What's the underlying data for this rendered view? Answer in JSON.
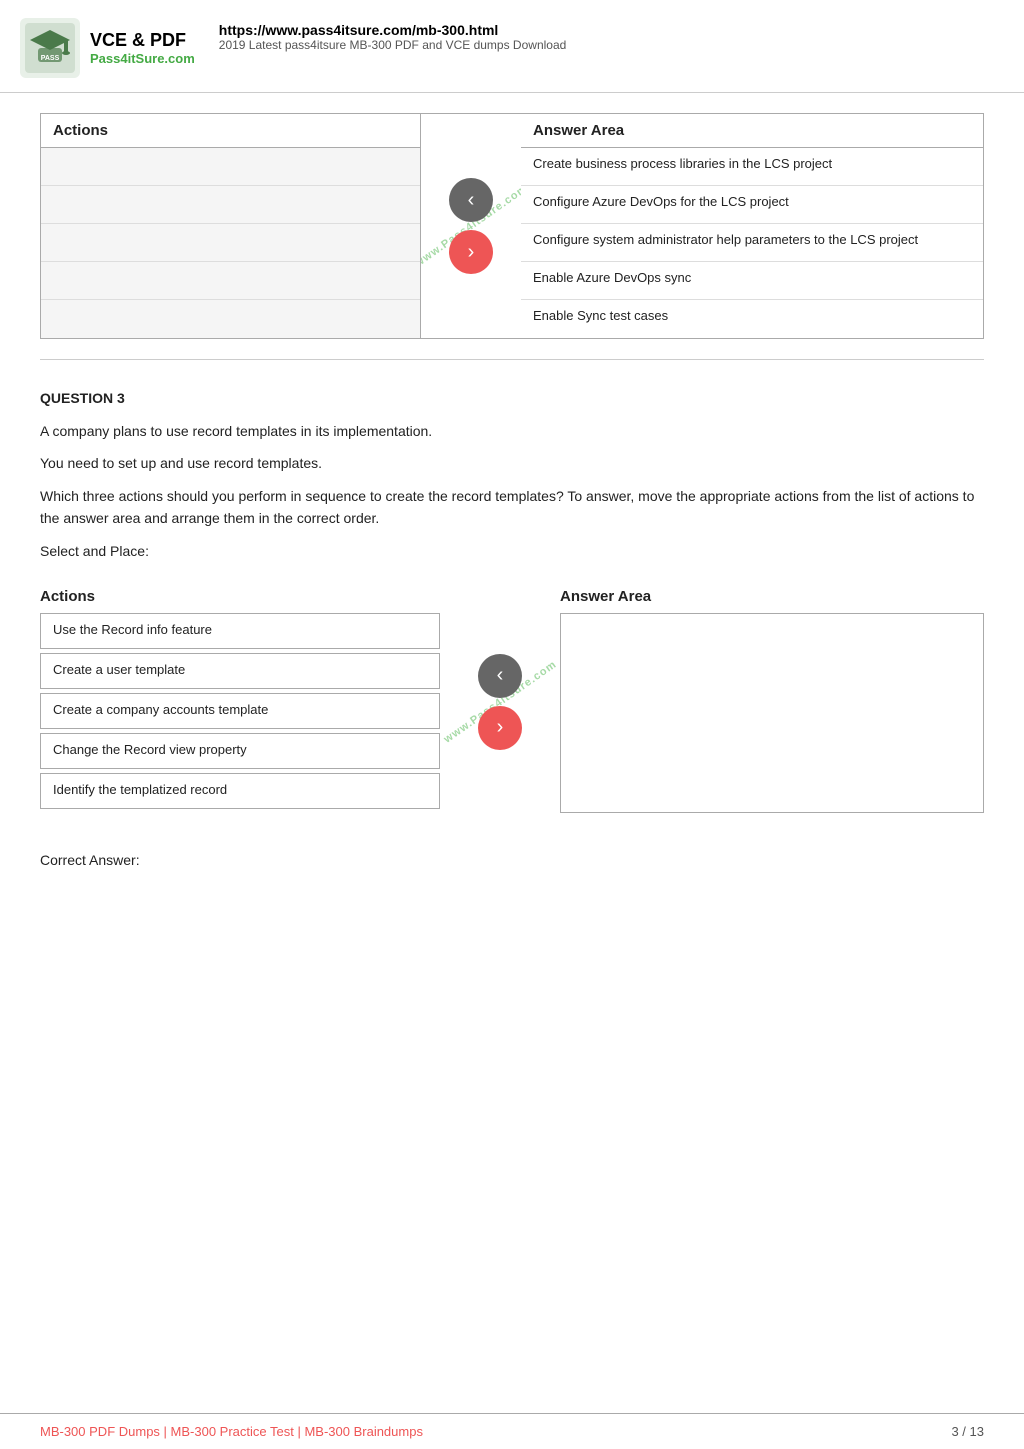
{
  "header": {
    "url": "https://www.pass4itsure.com/mb-300.html",
    "description": "2019 Latest pass4itsure MB-300 PDF and VCE dumps Download",
    "logo_line1": "VCE & PDF",
    "logo_line2": "Pass4itSure.com"
  },
  "section1": {
    "actions_header": "Actions",
    "answer_header": "Answer Area",
    "actions": [
      "",
      "",
      "",
      "",
      ""
    ],
    "answers": [
      "Create business process libraries in the LCS project",
      "Configure Azure DevOps for the LCS project",
      "Configure system administrator help parameters to the LCS project",
      "Enable Azure DevOps sync",
      "Enable Sync test cases"
    ]
  },
  "question3": {
    "number": "QUESTION 3",
    "paragraphs": [
      "A company plans to use record templates in its implementation.",
      "You need to set up and use record templates.",
      "Which three actions should you perform in sequence to create the record templates? To answer, move the appropriate actions from the list of actions to the answer area and arrange them in the correct order.",
      "Select and Place:"
    ]
  },
  "section2": {
    "actions_header": "Actions",
    "answer_header": "Answer Area",
    "actions": [
      "Use the Record info feature",
      "Create a user template",
      "Create a company accounts template",
      "Change the Record view property",
      "Identify the templatized record"
    ],
    "answers": []
  },
  "correct_answer": {
    "label": "Correct Answer:"
  },
  "footer": {
    "links": [
      "MB-300 PDF Dumps",
      "MB-300 Practice Test",
      "MB-300 Braindumps"
    ],
    "page": "3 / 13"
  }
}
